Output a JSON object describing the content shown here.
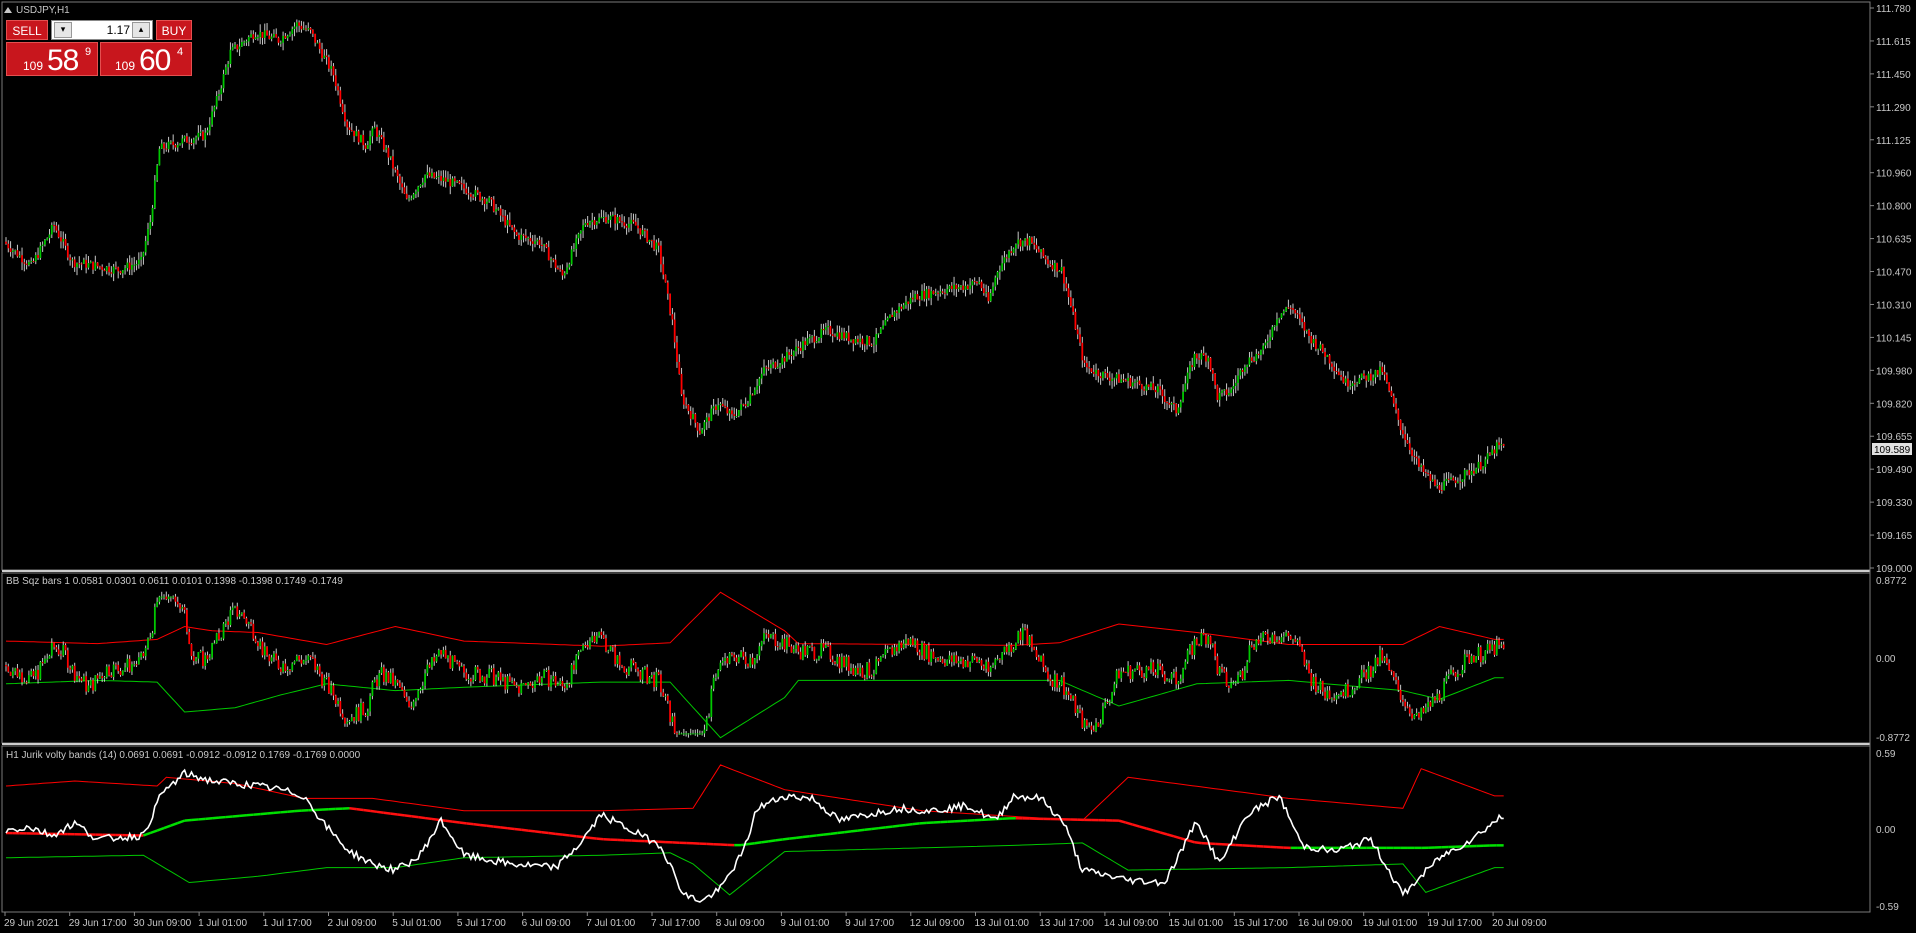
{
  "symbol_title": "USDJPY,H1",
  "trade_panel": {
    "sell_label": "SELL",
    "buy_label": "BUY",
    "lot": "1.17",
    "sell_price_prefix": "109",
    "sell_price_big": "58",
    "sell_price_sup": "9",
    "buy_price_prefix": "109",
    "buy_price_big": "60",
    "buy_price_sup": "4"
  },
  "main_axis_labels": [
    "111.780",
    "111.615",
    "111.450",
    "111.290",
    "111.125",
    "110.960",
    "110.800",
    "110.635",
    "110.470",
    "110.310",
    "110.145",
    "109.980",
    "109.820",
    "109.655",
    "109.490",
    "109.330",
    "109.165",
    "109.000"
  ],
  "current_price": "109.589",
  "panel1": {
    "title": "BB Sqz bars 1 0.0581 0.0301 0.0611 0.0101 0.1398 -0.1398 0.1749 -0.1749",
    "axis_labels": [
      "0.8772",
      "0.00",
      "-0.8772"
    ]
  },
  "panel2": {
    "title": "H1 Jurik volty bands (14) 0.0691 0.0691 -0.0912 -0.0912 0.1769 -0.1769 0.0000",
    "axis_labels": [
      "0.59",
      "0.00",
      "-0.59"
    ]
  },
  "time_labels": [
    "29 Jun 2021",
    "29 Jun 17:00",
    "30 Jun 09:00",
    "1 Jul 01:00",
    "1 Jul 17:00",
    "2 Jul 09:00",
    "5 Jul 01:00",
    "5 Jul 17:00",
    "6 Jul 09:00",
    "7 Jul 01:00",
    "7 Jul 17:00",
    "8 Jul 09:00",
    "9 Jul 01:00",
    "9 Jul 17:00",
    "12 Jul 09:00",
    "13 Jul 01:00",
    "13 Jul 17:00",
    "14 Jul 09:00",
    "15 Jul 01:00",
    "15 Jul 17:00",
    "16 Jul 09:00",
    "19 Jul 01:00",
    "19 Jul 17:00",
    "20 Jul 09:00"
  ],
  "colors": {
    "background": "#000000",
    "bull": "#00c800",
    "bear": "#ff0000",
    "wick": "#c8c8c8",
    "band_upper": "#ff0000",
    "band_lower": "#00c800",
    "jurik_line": "#ffffff"
  },
  "chart_data": [
    {
      "type": "candlestick",
      "title": "USDJPY,H1",
      "ylim": [
        109.0,
        111.78
      ],
      "anchors": [
        [
          0,
          110.62
        ],
        [
          12,
          110.5
        ],
        [
          22,
          110.7
        ],
        [
          30,
          110.52
        ],
        [
          50,
          110.48
        ],
        [
          60,
          110.52
        ],
        [
          64,
          110.72
        ],
        [
          68,
          111.08
        ],
        [
          78,
          111.12
        ],
        [
          88,
          111.15
        ],
        [
          93,
          111.32
        ],
        [
          99,
          111.56
        ],
        [
          110,
          111.66
        ],
        [
          120,
          111.62
        ],
        [
          128,
          111.7
        ],
        [
          134,
          111.66
        ],
        [
          144,
          111.45
        ],
        [
          150,
          111.2
        ],
        [
          158,
          111.1
        ],
        [
          162,
          111.18
        ],
        [
          168,
          111.05
        ],
        [
          176,
          110.82
        ],
        [
          184,
          110.95
        ],
        [
          194,
          110.92
        ],
        [
          202,
          110.88
        ],
        [
          212,
          110.82
        ],
        [
          224,
          110.65
        ],
        [
          234,
          110.62
        ],
        [
          244,
          110.45
        ],
        [
          254,
          110.72
        ],
        [
          264,
          110.74
        ],
        [
          276,
          110.7
        ],
        [
          286,
          110.58
        ],
        [
          292,
          110.22
        ],
        [
          296,
          109.85
        ],
        [
          304,
          109.68
        ],
        [
          312,
          109.82
        ],
        [
          318,
          109.75
        ],
        [
          324,
          109.82
        ],
        [
          332,
          109.98
        ],
        [
          342,
          110.05
        ],
        [
          350,
          110.12
        ],
        [
          360,
          110.18
        ],
        [
          370,
          110.14
        ],
        [
          380,
          110.12
        ],
        [
          388,
          110.26
        ],
        [
          398,
          110.35
        ],
        [
          410,
          110.38
        ],
        [
          420,
          110.4
        ],
        [
          426,
          110.42
        ],
        [
          430,
          110.32
        ],
        [
          434,
          110.48
        ],
        [
          442,
          110.62
        ],
        [
          448,
          110.62
        ],
        [
          456,
          110.52
        ],
        [
          462,
          110.48
        ],
        [
          466,
          110.3
        ],
        [
          472,
          110.0
        ],
        [
          482,
          109.95
        ],
        [
          494,
          109.92
        ],
        [
          504,
          109.88
        ],
        [
          512,
          109.78
        ],
        [
          520,
          110.05
        ],
        [
          526,
          110.05
        ],
        [
          530,
          109.85
        ],
        [
          536,
          109.88
        ],
        [
          542,
          110.02
        ],
        [
          550,
          110.08
        ],
        [
          556,
          110.25
        ],
        [
          562,
          110.3
        ],
        [
          570,
          110.15
        ],
        [
          578,
          110.05
        ],
        [
          586,
          109.92
        ],
        [
          596,
          109.95
        ],
        [
          602,
          109.98
        ],
        [
          610,
          109.7
        ],
        [
          618,
          109.5
        ],
        [
          626,
          109.4
        ],
        [
          636,
          109.45
        ],
        [
          646,
          109.52
        ],
        [
          652,
          109.6
        ]
      ],
      "last_price": 109.589
    },
    {
      "type": "area",
      "title": "BB Sqz bars 1",
      "ylim": [
        -0.8772,
        0.8772
      ],
      "upper": [
        [
          0,
          0.28
        ],
        [
          40,
          0.25
        ],
        [
          66,
          0.3
        ],
        [
          78,
          0.45
        ],
        [
          90,
          0.4
        ],
        [
          110,
          0.38
        ],
        [
          140,
          0.24
        ],
        [
          170,
          0.45
        ],
        [
          200,
          0.28
        ],
        [
          260,
          0.22
        ],
        [
          290,
          0.26
        ],
        [
          312,
          0.85
        ],
        [
          340,
          0.4
        ],
        [
          346,
          0.25
        ],
        [
          400,
          0.24
        ],
        [
          440,
          0.23
        ],
        [
          460,
          0.26
        ],
        [
          486,
          0.48
        ],
        [
          520,
          0.38
        ],
        [
          560,
          0.24
        ],
        [
          610,
          0.24
        ],
        [
          626,
          0.45
        ],
        [
          650,
          0.3
        ]
      ],
      "lower": [
        [
          0,
          -0.22
        ],
        [
          40,
          -0.18
        ],
        [
          66,
          -0.2
        ],
        [
          78,
          -0.55
        ],
        [
          100,
          -0.5
        ],
        [
          120,
          -0.35
        ],
        [
          140,
          -0.22
        ],
        [
          170,
          -0.3
        ],
        [
          200,
          -0.26
        ],
        [
          260,
          -0.2
        ],
        [
          290,
          -0.2
        ],
        [
          312,
          -0.85
        ],
        [
          340,
          -0.38
        ],
        [
          346,
          -0.18
        ],
        [
          400,
          -0.18
        ],
        [
          440,
          -0.18
        ],
        [
          460,
          -0.18
        ],
        [
          486,
          -0.48
        ],
        [
          520,
          -0.22
        ],
        [
          560,
          -0.18
        ],
        [
          610,
          -0.3
        ],
        [
          626,
          -0.4
        ],
        [
          650,
          -0.15
        ]
      ]
    },
    {
      "type": "line",
      "title": "H1 Jurik volty bands (14)",
      "ylim": [
        -0.59,
        0.59
      ],
      "upper": [
        [
          0,
          0.38
        ],
        [
          30,
          0.42
        ],
        [
          66,
          0.38
        ],
        [
          70,
          0.45
        ],
        [
          100,
          0.4
        ],
        [
          130,
          0.28
        ],
        [
          160,
          0.28
        ],
        [
          200,
          0.18
        ],
        [
          260,
          0.18
        ],
        [
          300,
          0.2
        ],
        [
          312,
          0.55
        ],
        [
          340,
          0.35
        ],
        [
          400,
          0.18
        ],
        [
          470,
          0.1
        ],
        [
          490,
          0.45
        ],
        [
          560,
          0.28
        ],
        [
          610,
          0.2
        ],
        [
          618,
          0.52
        ],
        [
          650,
          0.3
        ]
      ],
      "lower": [
        [
          0,
          -0.2
        ],
        [
          60,
          -0.18
        ],
        [
          80,
          -0.4
        ],
        [
          110,
          -0.35
        ],
        [
          140,
          -0.28
        ],
        [
          170,
          -0.28
        ],
        [
          200,
          -0.2
        ],
        [
          260,
          -0.18
        ],
        [
          290,
          -0.16
        ],
        [
          300,
          -0.25
        ],
        [
          316,
          -0.5
        ],
        [
          340,
          -0.15
        ],
        [
          440,
          -0.1
        ],
        [
          470,
          -0.08
        ],
        [
          490,
          -0.3
        ],
        [
          560,
          -0.28
        ],
        [
          610,
          -0.25
        ],
        [
          620,
          -0.48
        ],
        [
          650,
          -0.28
        ]
      ],
      "middle": [
        [
          0,
          0.0
        ],
        [
          60,
          -0.02
        ],
        [
          78,
          0.1
        ],
        [
          128,
          0.18
        ],
        [
          150,
          0.2
        ],
        [
          200,
          0.08
        ],
        [
          260,
          -0.05
        ],
        [
          320,
          -0.1
        ],
        [
          340,
          -0.05
        ],
        [
          400,
          0.08
        ],
        [
          440,
          0.12
        ],
        [
          486,
          0.1
        ],
        [
          520,
          -0.08
        ],
        [
          560,
          -0.12
        ],
        [
          620,
          -0.12
        ],
        [
          650,
          -0.1
        ]
      ],
      "signal": [
        [
          0,
          0.02
        ],
        [
          10,
          0.05
        ],
        [
          20,
          -0.02
        ],
        [
          30,
          0.08
        ],
        [
          40,
          -0.05
        ],
        [
          60,
          -0.02
        ],
        [
          68,
          0.32
        ],
        [
          78,
          0.48
        ],
        [
          90,
          0.42
        ],
        [
          100,
          0.4
        ],
        [
          110,
          0.38
        ],
        [
          120,
          0.35
        ],
        [
          130,
          0.3
        ],
        [
          140,
          0.05
        ],
        [
          150,
          -0.15
        ],
        [
          160,
          -0.25
        ],
        [
          170,
          -0.3
        ],
        [
          180,
          -0.2
        ],
        [
          190,
          0.1
        ],
        [
          200,
          -0.18
        ],
        [
          220,
          -0.25
        ],
        [
          240,
          -0.28
        ],
        [
          250,
          -0.1
        ],
        [
          260,
          0.15
        ],
        [
          270,
          0.05
        ],
        [
          286,
          -0.1
        ],
        [
          296,
          -0.5
        ],
        [
          304,
          -0.55
        ],
        [
          312,
          -0.45
        ],
        [
          322,
          -0.15
        ],
        [
          328,
          0.2
        ],
        [
          340,
          0.3
        ],
        [
          352,
          0.28
        ],
        [
          364,
          0.1
        ],
        [
          376,
          0.15
        ],
        [
          390,
          0.2
        ],
        [
          404,
          0.18
        ],
        [
          420,
          0.22
        ],
        [
          432,
          0.1
        ],
        [
          440,
          0.3
        ],
        [
          452,
          0.28
        ],
        [
          462,
          0.08
        ],
        [
          470,
          -0.3
        ],
        [
          490,
          -0.38
        ],
        [
          506,
          -0.4
        ],
        [
          520,
          0.1
        ],
        [
          530,
          -0.25
        ],
        [
          542,
          0.15
        ],
        [
          556,
          0.3
        ],
        [
          566,
          -0.1
        ],
        [
          580,
          -0.15
        ],
        [
          596,
          -0.05
        ],
        [
          610,
          -0.5
        ],
        [
          626,
          -0.2
        ],
        [
          640,
          -0.05
        ],
        [
          652,
          0.12
        ]
      ]
    }
  ]
}
